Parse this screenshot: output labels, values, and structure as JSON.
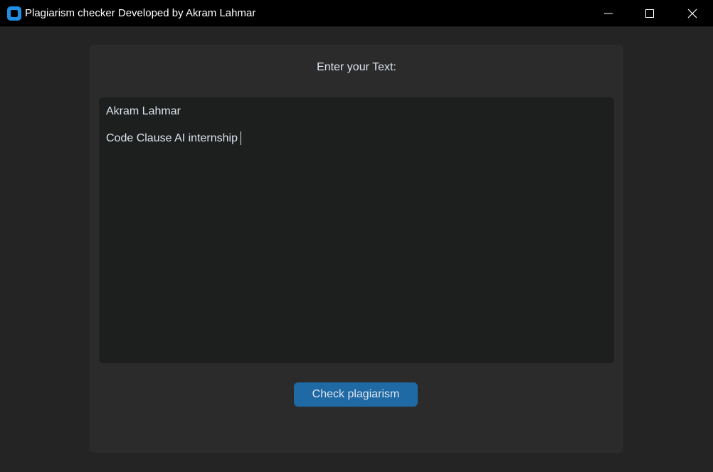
{
  "window": {
    "title": "Plagiarism checker Developed by Akram Lahmar",
    "icon": "app-icon",
    "controls": {
      "minimize": "minimize-icon",
      "maximize": "maximize-icon",
      "close": "close-icon"
    }
  },
  "main": {
    "prompt_label": "Enter your Text:",
    "text_input": {
      "lines": [
        "Akram Lahmar",
        "Code Clause AI internship"
      ]
    },
    "check_button_label": "Check plagiarism"
  },
  "colors": {
    "titlebar_bg": "#000000",
    "window_bg": "#242424",
    "frame_bg": "#2b2b2b",
    "textbox_bg": "#1d1e1e",
    "button_bg": "#1f6aa5",
    "text": "#dce4ee",
    "app_icon": "#1f8fe6"
  }
}
